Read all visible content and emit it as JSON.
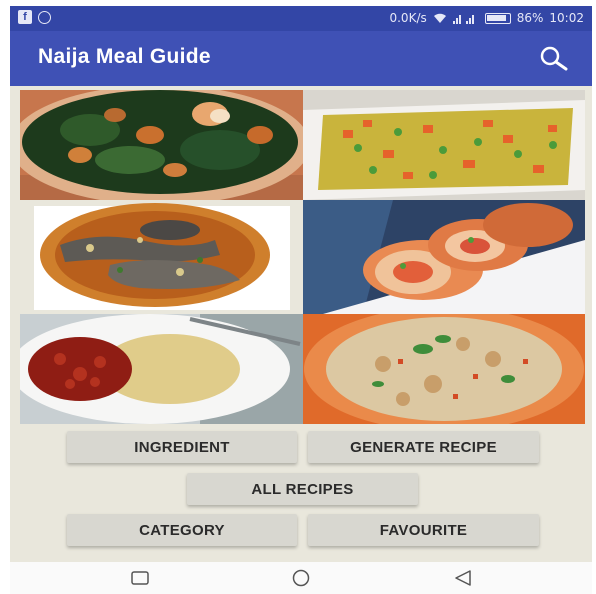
{
  "status_bar": {
    "network_speed": "0.0K/s",
    "battery": "86%",
    "time": "10:02",
    "icons": [
      "facebook-icon",
      "whatsapp-icon",
      "wifi-icon",
      "signal-icon",
      "battery-icon"
    ]
  },
  "app_bar": {
    "title": "Naija Meal Guide",
    "search_icon": "search-icon",
    "color": "#3f51b5"
  },
  "meal_images": [
    {
      "name": "vegetable-soup-image"
    },
    {
      "name": "fried-rice-image"
    },
    {
      "name": "catfish-pepper-soup-image"
    },
    {
      "name": "stuffed-roll-image"
    },
    {
      "name": "rice-and-stew-image"
    },
    {
      "name": "vegetable-rice-image"
    }
  ],
  "buttons": {
    "ingredient": "INGREDIENT",
    "generate_recipe": "GENERATE RECIPE",
    "all_recipes": "ALL RECIPES",
    "category": "CATEGORY",
    "favourite": "FAVOURITE"
  },
  "nav_bar": {
    "recent": "square-icon",
    "home": "circle-icon",
    "back": "triangle-back-icon"
  }
}
